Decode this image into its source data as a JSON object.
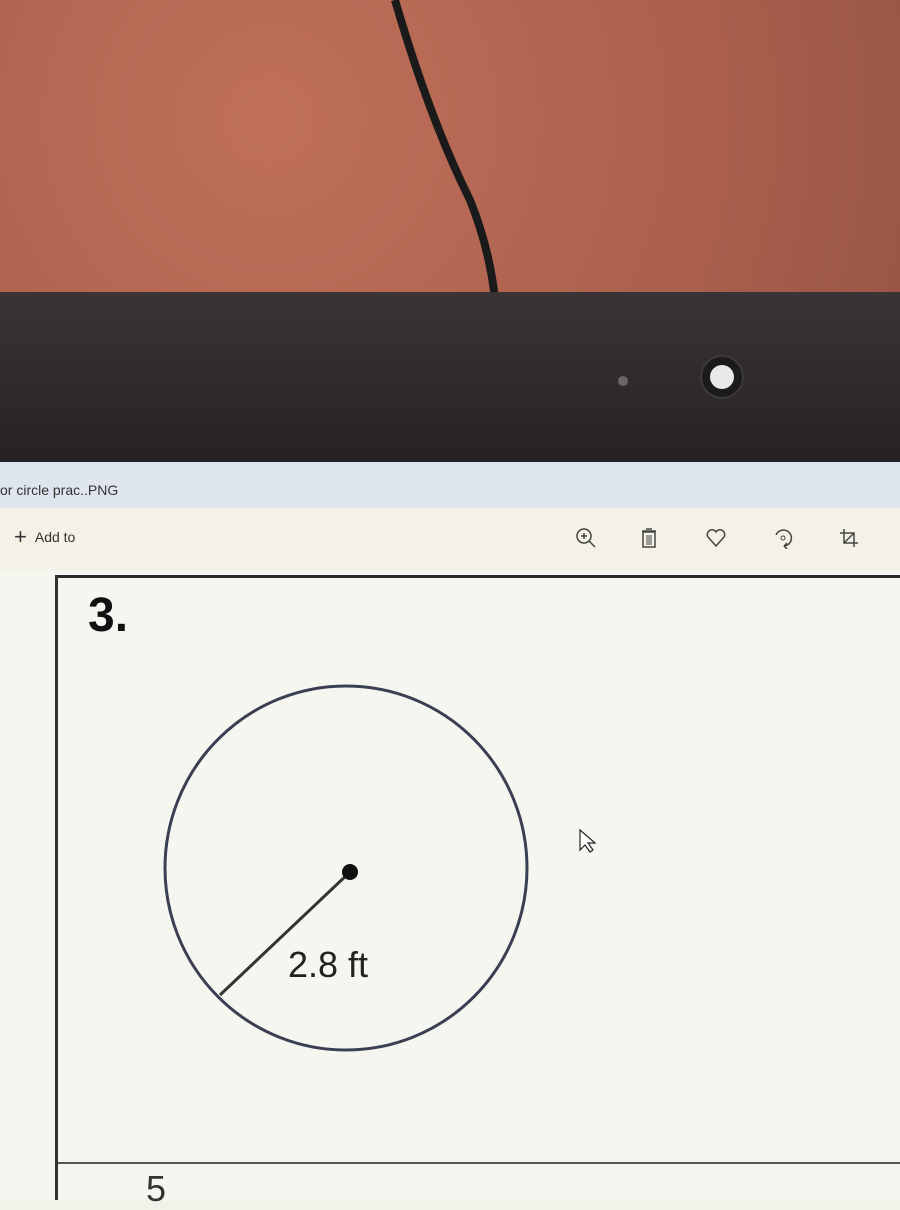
{
  "window": {
    "title": "or circle prac..PNG"
  },
  "toolbar": {
    "add_to_label": "Add to",
    "icons": [
      "zoom-in-icon",
      "delete-icon",
      "heart-icon",
      "rotate-icon",
      "crop-icon"
    ]
  },
  "problem": {
    "number": "3.",
    "radius_label": "2.8 ft",
    "next_number": "5"
  }
}
